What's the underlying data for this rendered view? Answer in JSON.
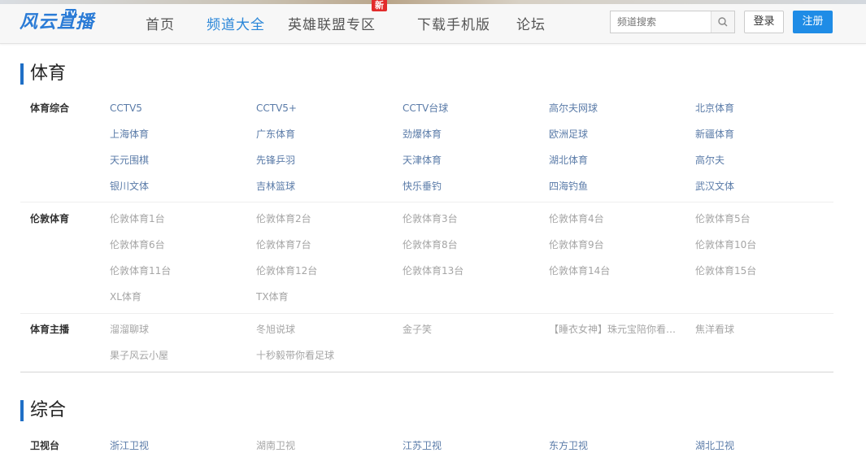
{
  "header": {
    "logo_text": "风云直播",
    "logo_badge": "TV",
    "nav": [
      {
        "label": "首页",
        "active": false
      },
      {
        "label": "频道大全",
        "active": true
      },
      {
        "label": "英雄联盟专区",
        "active": false,
        "badge": "新"
      },
      {
        "label": "下载手机版",
        "active": false
      },
      {
        "label": "论坛",
        "active": false
      }
    ],
    "search_placeholder": "频道搜索",
    "search_icon": "search-icon",
    "login_label": "登录",
    "register_label": "注册",
    "accent_color": "#1f8ce6"
  },
  "sections": [
    {
      "title": "体育",
      "groups": [
        {
          "label": "体育综合",
          "channels": [
            "CCTV5",
            "CCTV5+",
            "CCTV台球",
            "高尔夫网球",
            "北京体育",
            "上海体育",
            "广东体育",
            "劲爆体育",
            "欧洲足球",
            "新疆体育",
            "天元围棋",
            "先锋乒羽",
            "天津体育",
            "湖北体育",
            "高尔夫",
            "银川文体",
            "吉林篮球",
            "快乐垂钓",
            "四海钓鱼",
            "武汉文体"
          ],
          "style": "link"
        },
        {
          "label": "伦敦体育",
          "channels": [
            "伦敦体育1台",
            "伦敦体育2台",
            "伦敦体育3台",
            "伦敦体育4台",
            "伦敦体育5台",
            "伦敦体育6台",
            "伦敦体育7台",
            "伦敦体育8台",
            "伦敦体育9台",
            "伦敦体育10台",
            "伦敦体育11台",
            "伦敦体育12台",
            "伦敦体育13台",
            "伦敦体育14台",
            "伦敦体育15台",
            "XL体育",
            "TX体育"
          ],
          "style": "gray"
        },
        {
          "label": "体育主播",
          "channels": [
            "溜溜聊球",
            "冬旭说球",
            "金子笑",
            "【睡衣女神】珠元宝陪你看…",
            "焦洋看球",
            "果子风云小屋",
            "十秒毅带你看足球"
          ],
          "style": "gray"
        }
      ]
    },
    {
      "title": "综合",
      "groups": [
        {
          "label": "卫视台",
          "channels": [
            "浙江卫视",
            "湖南卫视",
            "江苏卫视",
            "东方卫视",
            "湖北卫视"
          ],
          "gray_indices": [
            1
          ],
          "style": "link"
        }
      ]
    }
  ]
}
